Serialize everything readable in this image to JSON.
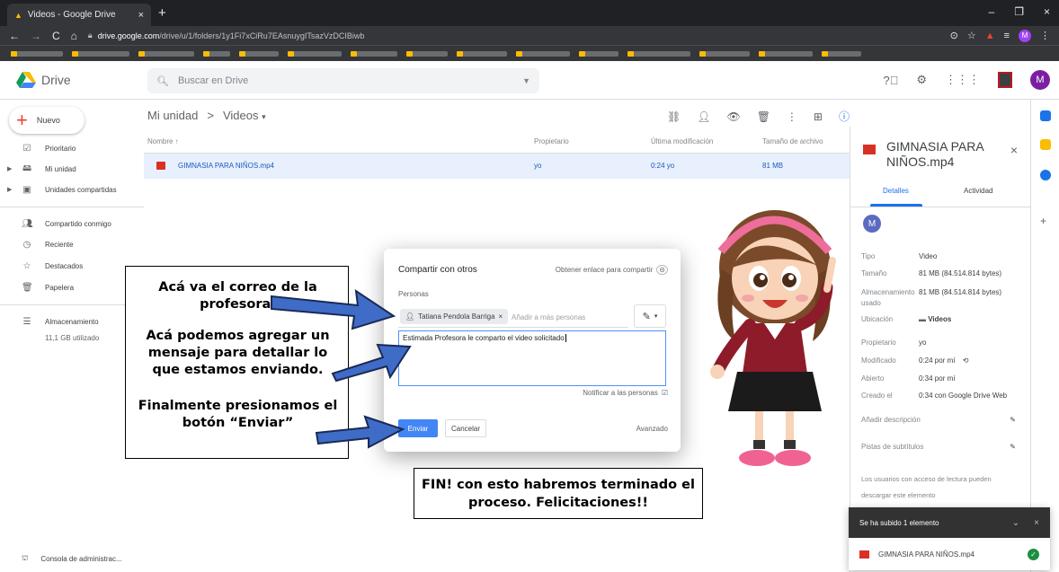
{
  "browser": {
    "tab_title": "Videos - Google Drive",
    "tab_close": "×",
    "new_tab": "+",
    "url_host": "drive.google.com",
    "url_path": "/drive/u/1/folders/1y1Fi7xCiRu7EAsnuygITsazVzDCIBiwb",
    "win_min": "–",
    "win_max": "❐",
    "win_close": "×",
    "avatar_letter": "M"
  },
  "drive": {
    "app_name": "Drive",
    "search_placeholder": "Buscar en Drive",
    "avatar_letter": "M"
  },
  "sidebar": {
    "new_label": "Nuevo",
    "items": [
      {
        "label": "Prioritario"
      },
      {
        "label": "Mi unidad"
      },
      {
        "label": "Unidades compartidas"
      },
      {
        "label": "Compartido conmigo"
      },
      {
        "label": "Reciente"
      },
      {
        "label": "Destacados"
      },
      {
        "label": "Papelera"
      },
      {
        "label": "Almacenamiento"
      }
    ],
    "storage_used": "11,1 GB utilizado",
    "admin_label": "Consola de administrac..."
  },
  "main": {
    "breadcrumb_root": "Mi unidad",
    "breadcrumb_sep": ">",
    "breadcrumb_current": "Videos",
    "columns": {
      "name": "Nombre ↑",
      "owner": "Propietario",
      "modified": "Última modificación",
      "size": "Tamaño de archivo"
    },
    "file": {
      "name": "GIMNASIA PARA NIÑOS.mp4",
      "owner": "yo",
      "modified": "0:24 yo",
      "size": "81 MB"
    }
  },
  "details": {
    "title": "GIMNASIA PARA NIÑOS.mp4",
    "tab_details": "Detalles",
    "tab_activity": "Actividad",
    "avatar_letter": "M",
    "rows": [
      {
        "label": "Tipo",
        "value": "Video"
      },
      {
        "label": "Tamaño",
        "value": "81 MB (84.514.814 bytes)"
      },
      {
        "label": "Almacenamiento usado",
        "value": "81 MB (84.514.814 bytes)"
      },
      {
        "label": "Ubicación",
        "value": "Videos"
      },
      {
        "label": "Propietario",
        "value": "yo"
      },
      {
        "label": "Modificado",
        "value": "0:24 por mí"
      },
      {
        "label": "Abierto",
        "value": "0:34 por mí"
      },
      {
        "label": "Creado el",
        "value": "0:34 con Google Drive Web"
      }
    ],
    "add_description": "Añadir descripción",
    "subtitles": "Pistas de subtítulos",
    "note": "Los usuarios con acceso de lectura pueden descargar este elemento"
  },
  "dialog": {
    "title": "Compartir con otros",
    "get_link": "Obtener enlace para compartir",
    "people_label": "Personas",
    "chip_name": "Tatiana Pendola Barriga",
    "chip_remove": "×",
    "add_more": "Añadir a más personas",
    "message": "Estimada Profesora le comparto el video solicitado",
    "notify": "Notificar a las personas",
    "send": "Enviar",
    "cancel": "Cancelar",
    "advanced": "Avanzado"
  },
  "annotations": {
    "a1": "Acá va el correo de la profesora.",
    "a2": "Acá podemos agregar un mensaje para detallar lo que estamos enviando.",
    "a3": "Finalmente presionamos el botón “Enviar”",
    "fin": "FIN! con esto habremos terminado el proceso. Felicitaciones!!"
  },
  "upload": {
    "header": "Se ha subido 1 elemento",
    "file": "GIMNASIA PARA NIÑOS.mp4"
  },
  "colors": {
    "accent": "#1a73e8",
    "selected_row": "#e8f0fe",
    "video_red": "#d93025",
    "send_blue": "#4285f4"
  }
}
